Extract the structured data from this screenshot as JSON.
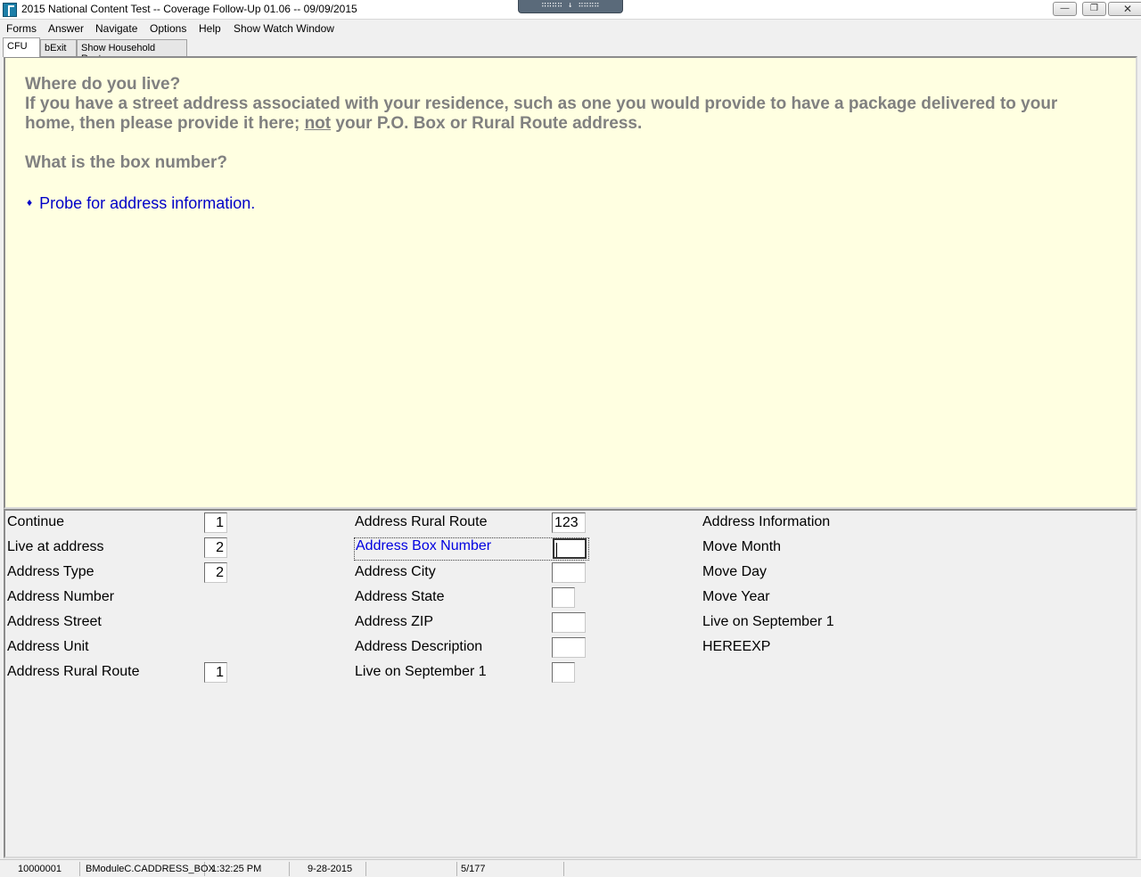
{
  "window": {
    "title": "2015 National Content Test -- Coverage Follow-Up 01.06 -- 09/09/2015",
    "grip": "∷∷∷∷ ↓ ∷∷∷∷",
    "minimize": "—",
    "restore": "❐",
    "close": "✕"
  },
  "menu": {
    "forms": "Forms",
    "answer": "Answer",
    "navigate": "Navigate",
    "options": "Options",
    "help": "Help",
    "watch": "Show Watch Window"
  },
  "tabs": {
    "cfu": "CFU",
    "bexit": "bExit",
    "roster": "Show Household Roster"
  },
  "question": {
    "line1": "Where do you live?",
    "line2_part1": "If you have a street address associated with your residence, such as one you would provide to have a package delivered to your home, then please provide it here; ",
    "line2_underlined": "not",
    "line2_part2": " your P.O. Box or Rural Route address.",
    "line3": "What is the box number?",
    "probe": "Probe for address information.",
    "probe_bullet": "♦"
  },
  "fields": {
    "col1": [
      {
        "label": "Continue",
        "value": "1"
      },
      {
        "label": "Live at address",
        "value": "2"
      },
      {
        "label": "Address Type",
        "value": "2"
      },
      {
        "label": "Address Number",
        "value": ""
      },
      {
        "label": "Address Street",
        "value": ""
      },
      {
        "label": "Address Unit",
        "value": ""
      },
      {
        "label": "Address Rural Route",
        "value": "1"
      }
    ],
    "col2": [
      {
        "label": "Address Rural Route",
        "value": "123"
      },
      {
        "label": "Address Box Number",
        "value": ""
      },
      {
        "label": "Address City",
        "value": ""
      },
      {
        "label": "Address State",
        "value": ""
      },
      {
        "label": "Address ZIP",
        "value": ""
      },
      {
        "label": "Address Description",
        "value": ""
      },
      {
        "label": "Live on September 1",
        "value": ""
      }
    ],
    "col3": [
      {
        "label": "Address Information"
      },
      {
        "label": "Move Month"
      },
      {
        "label": "Move Day"
      },
      {
        "label": "Move Year"
      },
      {
        "label": "Live on September 1"
      },
      {
        "label": "HEREEXP"
      }
    ]
  },
  "status": {
    "case_id": "10000001",
    "field_path": "BModuleC.CADDRESS_BOX",
    "time": "1:32:25 PM",
    "date": "9-28-2015",
    "page": "5/177"
  },
  "colors": {
    "question_bg": "#ffffe1",
    "question_text": "#808080",
    "probe_text": "#0000c8",
    "current_field": "#0000e0"
  }
}
